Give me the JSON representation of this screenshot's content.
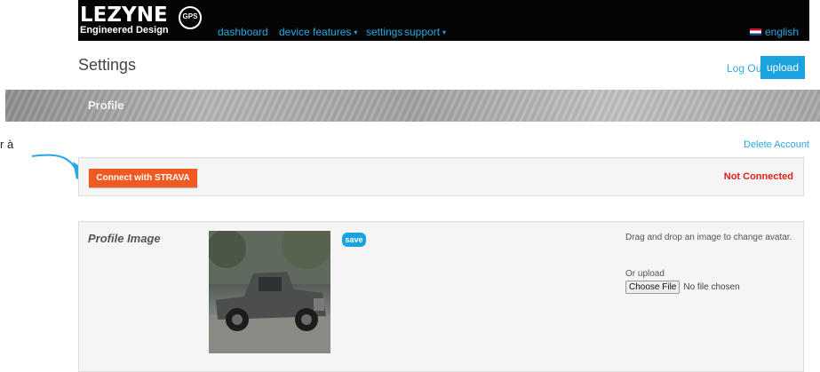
{
  "nav": {
    "logo_word": "LEZYNE",
    "logo_tagline": "Engineered Design",
    "logo_badge": "GPS ROOT",
    "items": [
      {
        "label": "dashboard",
        "caret": ""
      },
      {
        "label": "device features",
        "caret": "▾"
      },
      {
        "label": "settings",
        "caret": ""
      },
      {
        "label": "support",
        "caret": "▾"
      }
    ],
    "language": "english"
  },
  "header": {
    "title": "Settings",
    "logout": "Log Out",
    "upload": "upload"
  },
  "profile_banner": {
    "label": "Profile"
  },
  "cut_text": "r à",
  "account": {
    "delete_label": "Delete Account"
  },
  "strava": {
    "connect_label": "Connect with STRAVA",
    "status": "Not Connected"
  },
  "profile_image": {
    "label": "Profile Image",
    "save_label": "save",
    "drag_text": "Drag and drop an image to change avatar.",
    "or_upload": "Or upload",
    "choose_file": "Choose File",
    "no_file": "No file chosen"
  },
  "colors": {
    "accent": "#1aa3df",
    "strava": "#f05a20",
    "error": "#d9211b",
    "nav_bg": "#050505"
  }
}
